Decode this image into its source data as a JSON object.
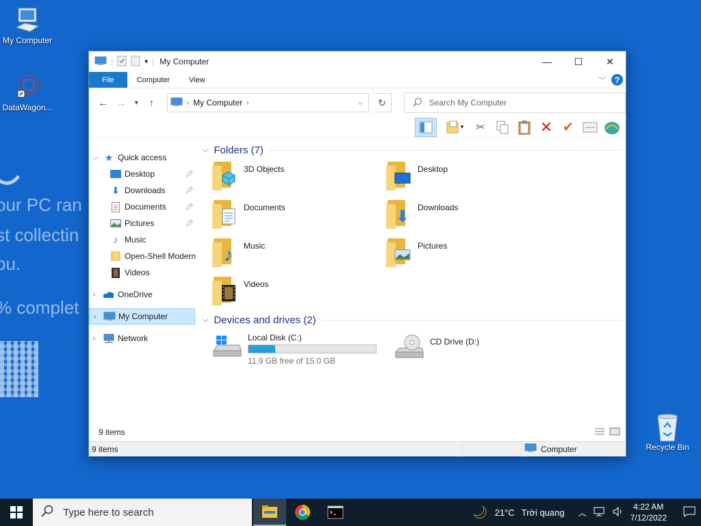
{
  "desktop": {
    "icons": [
      {
        "label": "My Computer"
      },
      {
        "label": "DataWagon..."
      },
      {
        "label": "Recycle Bin"
      }
    ],
    "background_text": [
      "our PC ran",
      "st collectin",
      "ou.",
      "% complet"
    ]
  },
  "window": {
    "title": "My Computer",
    "ribbon_tabs": [
      "File",
      "Computer",
      "View"
    ],
    "address": {
      "location": "My Computer"
    },
    "search_placeholder": "Search My Computer",
    "navigation": {
      "quick_access": "Quick access",
      "quick_items": [
        {
          "label": "Desktop",
          "pinned": true
        },
        {
          "label": "Downloads",
          "pinned": true
        },
        {
          "label": "Documents",
          "pinned": true
        },
        {
          "label": "Pictures",
          "pinned": true
        },
        {
          "label": "Music",
          "pinned": false
        },
        {
          "label": "Open-Shell Modern",
          "pinned": false
        },
        {
          "label": "Videos",
          "pinned": false
        }
      ],
      "onedrive": "OneDrive",
      "my_computer": "My Computer",
      "network": "Network"
    },
    "folders_header": "Folders (7)",
    "folders": [
      "3D Objects",
      "Desktop",
      "Documents",
      "Downloads",
      "Music",
      "Pictures",
      "Videos"
    ],
    "devices_header": "Devices and drives (2)",
    "drives": [
      {
        "name": "Local Disk (C:)",
        "free_text": "11.9 GB free of 15.0 GB",
        "used_fraction": 0.21
      },
      {
        "name": "CD Drive (D:)"
      }
    ],
    "status": {
      "item_count": "9 items",
      "bottom_count": "9 items",
      "location": "Computer"
    }
  },
  "taskbar": {
    "search_placeholder": "Type here to search",
    "weather": {
      "temp": "21°C",
      "condition": "Trời quang"
    },
    "time": "4:22 AM",
    "date": "7/12/2022"
  },
  "colors": {
    "accent": "#1979ca",
    "desktop": "#1366cc",
    "taskbar": "#101d2b",
    "drive_bar": "#26a0da"
  }
}
